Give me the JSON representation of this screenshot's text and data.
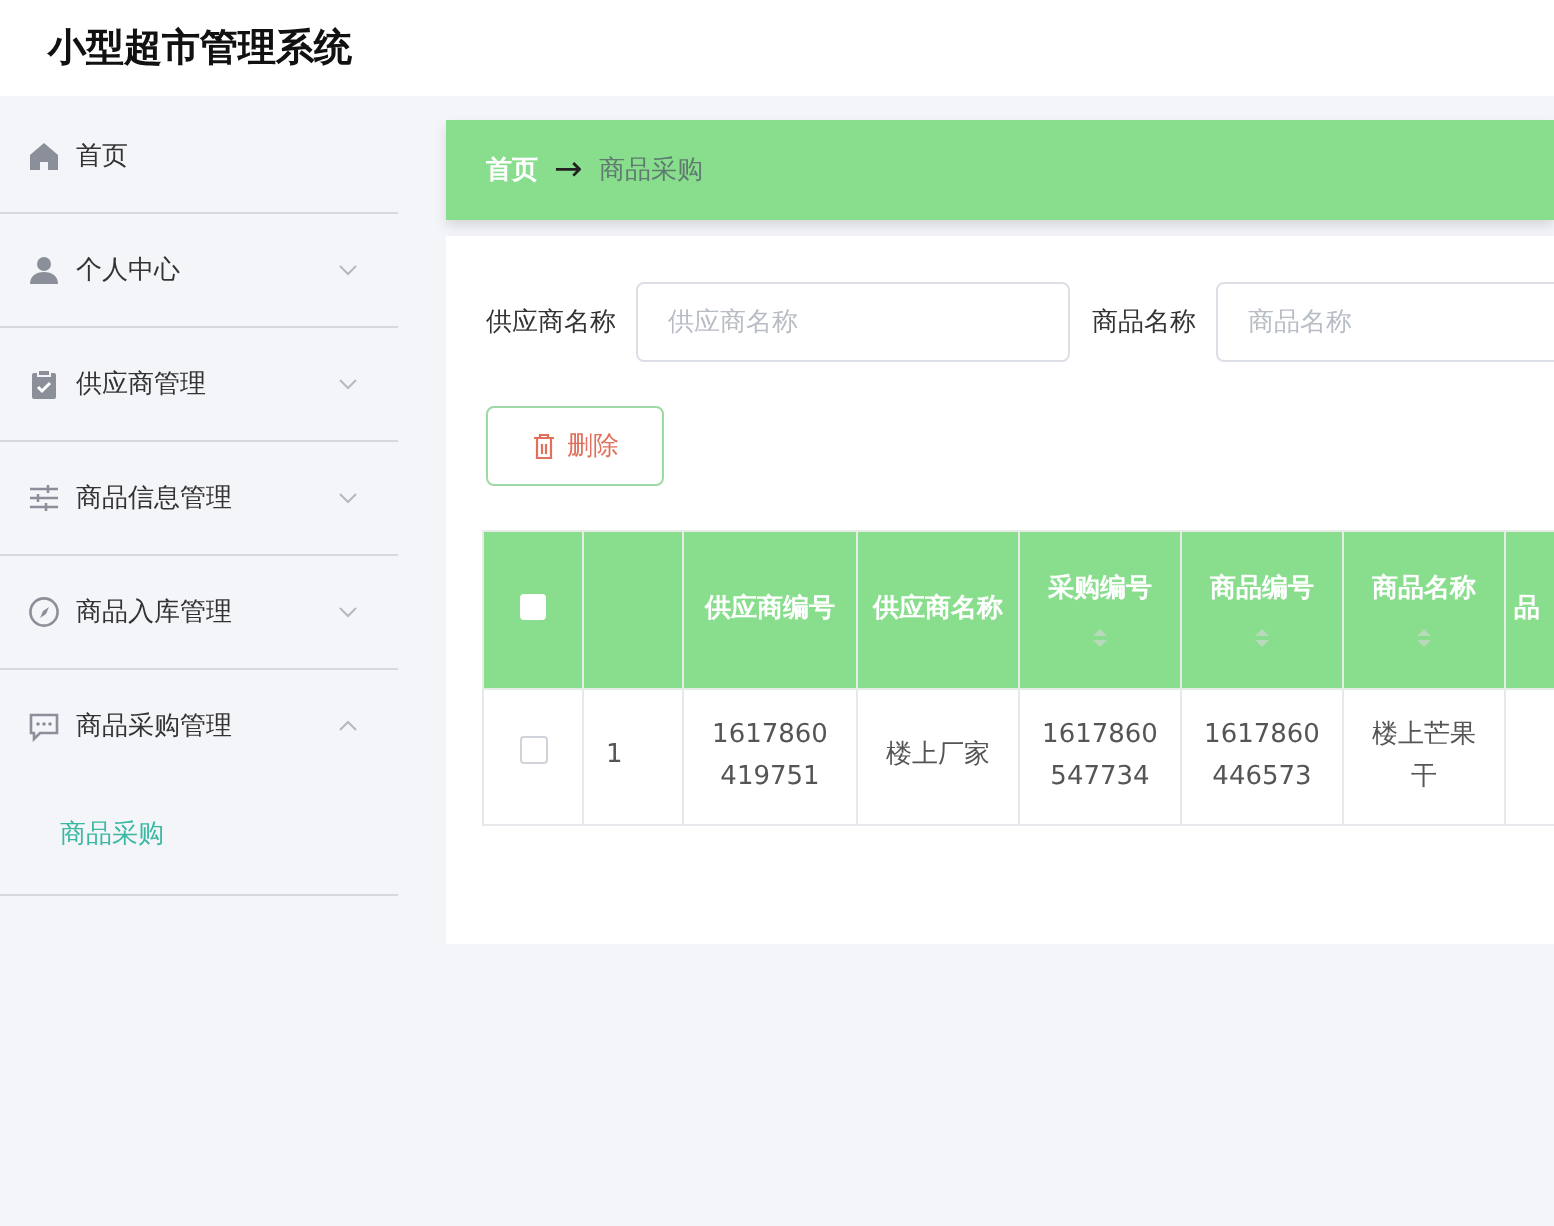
{
  "app_title": "小型超市管理系统",
  "sidebar": {
    "items": [
      {
        "label": "首页"
      },
      {
        "label": "个人中心",
        "expanded": false,
        "has_children": true
      },
      {
        "label": "供应商管理",
        "expanded": false,
        "has_children": true
      },
      {
        "label": "商品信息管理",
        "expanded": false,
        "has_children": true
      },
      {
        "label": "商品入库管理",
        "expanded": false,
        "has_children": true
      },
      {
        "label": "商品采购管理",
        "expanded": true,
        "has_children": true,
        "children": [
          {
            "label": "商品采购",
            "selected": true
          }
        ]
      }
    ]
  },
  "breadcrumb": {
    "home": "首页",
    "separator": "→",
    "current": "商品采购"
  },
  "filters": [
    {
      "label": "供应商名称",
      "placeholder": "供应商名称"
    },
    {
      "label": "商品名称",
      "placeholder": "商品名称"
    }
  ],
  "delete_button": "删除",
  "table": {
    "select_all_checked": false,
    "columns": [
      {
        "label": "供应商编号",
        "sortable": false
      },
      {
        "label": "供应商名称",
        "sortable": false
      },
      {
        "label": "采购编号",
        "sortable": true
      },
      {
        "label": "商品编号",
        "sortable": true
      },
      {
        "label": "商品名称",
        "sortable": true
      },
      {
        "label": "品",
        "sortable": false
      }
    ],
    "rows": [
      {
        "checked": false,
        "index": "1",
        "cells": [
          "1617860419751",
          "楼上厂家",
          "1617860547734",
          "1617860446573",
          "楼上芒果干",
          ""
        ]
      }
    ]
  }
}
